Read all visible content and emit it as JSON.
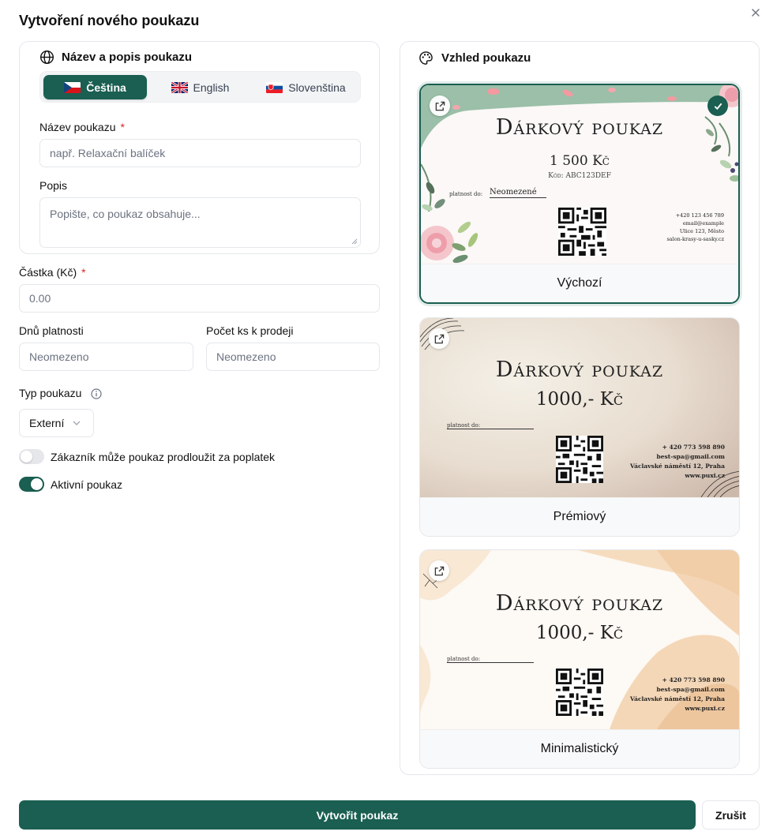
{
  "dialog": {
    "title": "Vytvoření nového poukazu",
    "close_icon": "close-icon"
  },
  "name_section": {
    "heading": "Název a popis poukazu",
    "icon": "globe-icon",
    "languages": [
      {
        "label": "Čeština",
        "flag": "cz-flag-icon",
        "active": true
      },
      {
        "label": "English",
        "flag": "gb-flag-icon",
        "active": false
      },
      {
        "label": "Slovenština",
        "flag": "sk-flag-icon",
        "active": false
      }
    ],
    "name_label": "Název poukazu",
    "name_required": "*",
    "name_placeholder": "např. Relaxační balíček",
    "desc_label": "Popis",
    "desc_placeholder": "Popište, co poukaz obsahuje..."
  },
  "form": {
    "amount_label": "Částka (Kč)",
    "amount_required": "*",
    "amount_placeholder": "0.00",
    "validity_label": "Dnů platnosti",
    "validity_placeholder": "Neomezeno",
    "count_label": "Počet ks k prodeji",
    "count_placeholder": "Neomezeno",
    "type_label": "Typ poukazu",
    "type_value": "Externí",
    "extend_label": "Zákazník může poukaz prodloužit za poplatek",
    "extend_on": false,
    "active_label": "Aktivní poukaz",
    "active_on": true
  },
  "look_section": {
    "heading": "Vzhled poukazu",
    "icon": "palette-icon",
    "templates": [
      {
        "name": "Výchozí",
        "selected": true,
        "title": "Dárkový poukaz",
        "amount": "1 500 Kč",
        "code": "Kód: ABC123DEF",
        "valid_label": "platnost do:",
        "valid_value": "Neomezené",
        "contact": [
          "+420 123 456 789",
          "email@example",
          "Ulice 123, Město",
          "salon-krasy-u-sasky.cz"
        ]
      },
      {
        "name": "Prémiový",
        "selected": false,
        "title": "Dárkový poukaz",
        "amount": "1000,- Kč",
        "valid_label": "platnost do:",
        "contact": [
          "+ 420 773 598 890",
          "best-spa@gmail.com",
          "Václavské náměstí 12, Praha",
          "www.puxi.cz"
        ]
      },
      {
        "name": "Minimalistický",
        "selected": false,
        "title": "Dárkový poukaz",
        "amount": "1000,- Kč",
        "valid_label": "platnost do:",
        "contact": [
          "+ 420 773 598 890",
          "best-spa@gmail.com",
          "Václavské náměstí 12, Praha",
          "www.puxi.cz"
        ]
      }
    ]
  },
  "actions": {
    "submit": "Vytvořit poukaz",
    "cancel": "Zrušit"
  },
  "colors": {
    "brand": "#1a5f51",
    "required": "#dc2626"
  }
}
